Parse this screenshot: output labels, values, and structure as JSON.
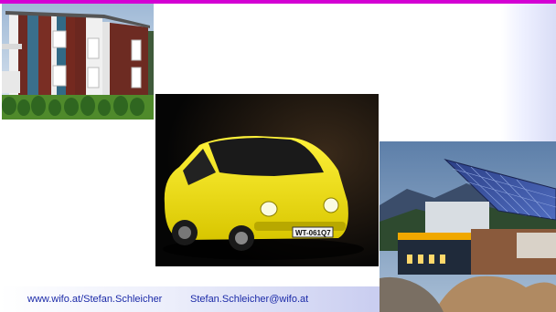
{
  "footer": {
    "url": "www.wifo.at/Stefan.Schleicher",
    "email": "Stefan.Schleicher@wifo.at"
  },
  "photos": {
    "car": {
      "plate": "WT-061Q7"
    }
  },
  "colors": {
    "top_bar": "#d400d4",
    "footer_text": "#1b2aa8"
  }
}
